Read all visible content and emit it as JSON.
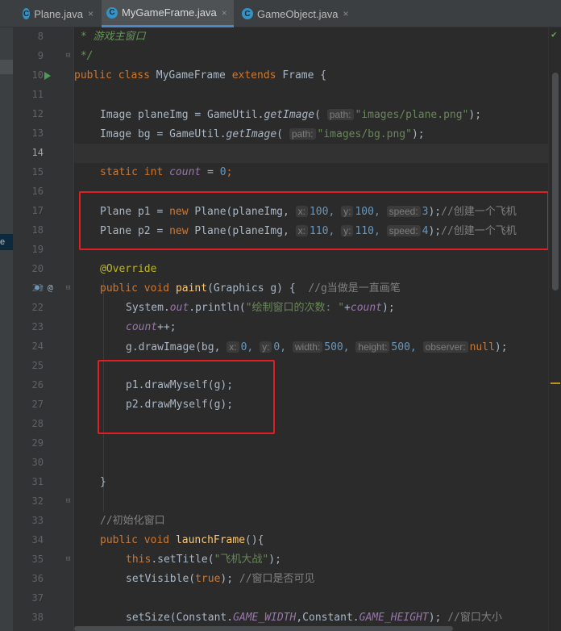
{
  "tabs": [
    {
      "label": "Plane.java",
      "active": false
    },
    {
      "label": "MyGameFrame.java",
      "active": true
    },
    {
      "label": "GameObject.java",
      "active": false
    }
  ],
  "tab_icon_letter": "C",
  "close_glyph": "×",
  "left_strip_label": "e",
  "line_numbers": [
    "8",
    "9",
    "10",
    "11",
    "12",
    "13",
    "14",
    "15",
    "16",
    "17",
    "18",
    "19",
    "20",
    "21",
    "22",
    "23",
    "24",
    "25",
    "26",
    "27",
    "28",
    "29",
    "30",
    "31",
    "32",
    "33",
    "34",
    "35",
    "36",
    "37",
    "38"
  ],
  "code": {
    "l8_comment": " * 游戏主窗口",
    "l9_comment": " */",
    "l10": {
      "k1": "public",
      "k2": "class",
      "name": "MyGameFrame",
      "k3": "extends",
      "parent": "Frame {"
    },
    "l12": {
      "type": "Image",
      "var": "planeImg = GameUtil.",
      "method": "getImage",
      "open": "(",
      "hint": "path:",
      "str": "\"images/plane.png\"",
      "close": ");"
    },
    "l13": {
      "type": "Image",
      "var": "bg = GameUtil.",
      "method": "getImage",
      "open": "(",
      "hint": "path:",
      "str": "\"images/bg.png\"",
      "close": ");"
    },
    "l15": {
      "k1": "static",
      "k2": "int",
      "field": "count",
      "eq": " = ",
      "num": "0",
      "end": ";"
    },
    "l17": {
      "pre": "Plane p1 = ",
      "kw": "new",
      "call": " Plane(planeImg,",
      "h1": "x:",
      "n1": "100,",
      "h2": "y:",
      "n2": "100,",
      "h3": "speed:",
      "n3": "3",
      "end": ");",
      "cmt": "//创建一个飞机"
    },
    "l18": {
      "pre": "Plane p2 = ",
      "kw": "new",
      "call": " Plane(planeImg,",
      "h1": "x:",
      "n1": "110,",
      "h2": "y:",
      "n2": "110,",
      "h3": "speed:",
      "n3": "4",
      "end": ");",
      "cmt": "//创建一个飞机"
    },
    "l20_ann": "@Override",
    "l21": {
      "k1": "public",
      "k2": "void",
      "method": "paint",
      "params": "(Graphics g) {  ",
      "cmt": "//g当做是一直画笔"
    },
    "l22": {
      "pre": "System.",
      "field": "out",
      "mid": ".println(",
      "str": "\"绘制窗口的次数: \"",
      "plus": "+",
      "field2": "count",
      "end": ");"
    },
    "l23": {
      "field": "count",
      "end": "++;"
    },
    "l24": {
      "pre": "g.drawImage(bg,",
      "h1": "x:",
      "n1": "0,",
      "h2": "y:",
      "n2": "0,",
      "h3": "width:",
      "n3": "500,",
      "h4": "height:",
      "n4": "500,",
      "h5": "observer:",
      "kw": "null",
      "end": ");"
    },
    "l26": "p1.drawMyself(g);",
    "l27": "p2.drawMyself(g);",
    "l31": "}",
    "l33_cmt": "//初始化窗口",
    "l34": {
      "k1": "public",
      "k2": "void",
      "method": "launchFrame",
      "end": "(){"
    },
    "l35": {
      "kw": "this",
      "mid": ".setTitle(",
      "str": "\"飞机大战\"",
      "end": ");"
    },
    "l36": {
      "pre": "setVisible(",
      "kw": "true",
      "end": "); ",
      "cmt": "//窗口是否可见"
    },
    "l38": {
      "pre": "setSize(Constant.",
      "f1": "GAME_WIDTH",
      "mid": ",Constant.",
      "f2": "GAME_HEIGHT",
      "end": "); ",
      "cmt": "//窗口大小"
    }
  },
  "colors": {
    "keyword": "#cc7832",
    "string": "#6a8759",
    "number": "#6897bb",
    "field": "#9876aa",
    "method": "#ffc66d",
    "comment": "#808080",
    "annotation": "#bbb529",
    "highlight_box": "#e02020"
  }
}
